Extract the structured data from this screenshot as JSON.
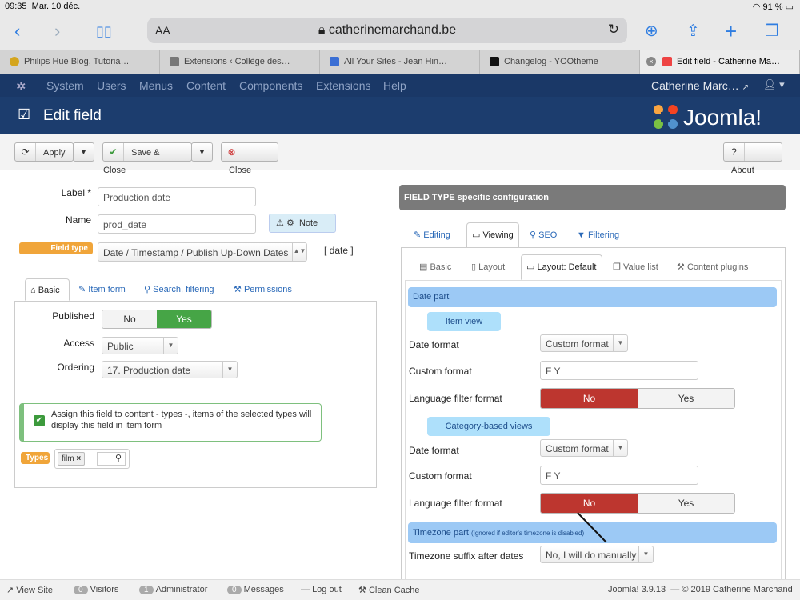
{
  "status": {
    "time": "09:35",
    "date": "Mar. 10 déc.",
    "battery": "91 %"
  },
  "browser": {
    "aa": "AA",
    "url": "catherinemarchand.be"
  },
  "tabs": [
    {
      "title": "Philips Hue Blog, Tutoria…"
    },
    {
      "title": "Extensions ‹ Collège des…"
    },
    {
      "title": "All Your Sites - Jean Hin…"
    },
    {
      "title": "Changelog - YOOtheme"
    },
    {
      "title": "Edit field - Catherine Ma…"
    }
  ],
  "jnav": {
    "items": [
      "System",
      "Users",
      "Menus",
      "Content",
      "Components",
      "Extensions",
      "Help"
    ],
    "user": "Catherine Marc…"
  },
  "header": {
    "title": "Edit field",
    "brand": "Joomla!"
  },
  "actions": {
    "apply": "Apply",
    "save_close": "Save & Close",
    "close": "Close",
    "about": "About"
  },
  "form": {
    "label_label": "Label *",
    "label_value": "Production date",
    "name_label": "Name",
    "name_value": "prod_date",
    "note_label": "Note",
    "fieldtype_label": "Field type",
    "fieldtype_value": "Date / Timestamp / Publish Up-Down Dates",
    "fieldtype_code": "[ date ]"
  },
  "lefttabs": {
    "basic": "Basic",
    "itemform": "Item form",
    "search": "Search, filtering",
    "permissions": "Permissions"
  },
  "basic": {
    "published_label": "Published",
    "no": "No",
    "yes": "Yes",
    "access_label": "Access",
    "access_value": "Public",
    "ordering_label": "Ordering",
    "ordering_value": "17. Production date",
    "assign_text": "Assign this field to content - types -, items of the selected types will display this field in item form",
    "types_label": "Types",
    "type_tag": "film"
  },
  "right": {
    "header": "FIELD TYPE specific configuration",
    "tabs": {
      "editing": "Editing",
      "viewing": "Viewing",
      "seo": "SEO",
      "filtering": "Filtering"
    },
    "subtabs": {
      "basic": "Basic",
      "layout": "Layout",
      "layout_default": "Layout: Default",
      "value_list": "Value list",
      "content_plugins": "Content plugins"
    },
    "date_part": "Date part",
    "item_view": "Item view",
    "date_format_label": "Date format",
    "date_format_value": "Custom format",
    "custom_format_label": "Custom format",
    "custom_format_value": "F Y",
    "lang_filter_label": "Language filter format",
    "no": "No",
    "yes": "Yes",
    "category_views": "Category-based views",
    "date_format_value2": "Custom format",
    "custom_format_value2": "F Y",
    "timezone_part": "Timezone part",
    "timezone_note": "(Ignored if editor's timezone is disabled)",
    "tz_suffix_label": "Timezone suffix after dates",
    "tz_suffix_value": "No, I will do manually"
  },
  "footer": {
    "view_site": "View Site",
    "visitors_count": "0",
    "visitors": "Visitors",
    "admin_count": "1",
    "admin": "Administrator",
    "msg_count": "0",
    "messages": "Messages",
    "logout": "Log out",
    "clean_cache": "Clean Cache",
    "version": "Joomla! 3.9.13",
    "copyright": "—  © 2019 Catherine Marchand"
  }
}
